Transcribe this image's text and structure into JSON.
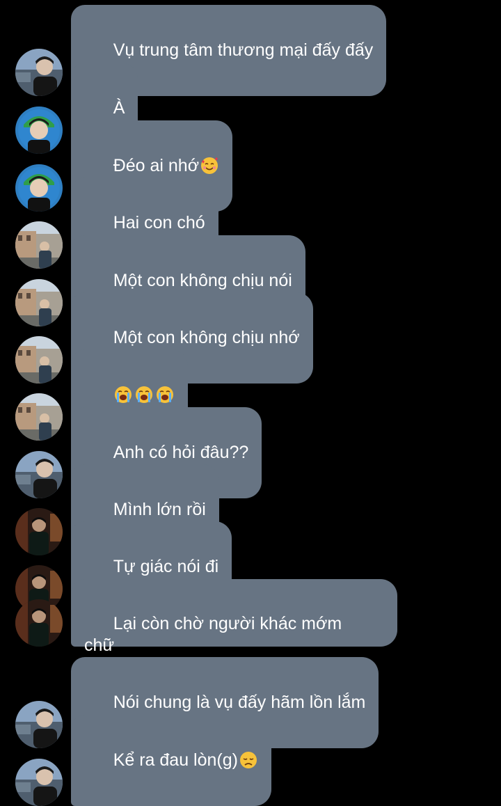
{
  "messages": [
    {
      "avatar": "avatar-city-boy",
      "text": "Vụ trung tâm thương mại đấy đấy"
    },
    {
      "avatar": "avatar-green-cap",
      "text": "À"
    },
    {
      "avatar": "avatar-green-cap",
      "text": "Đéo ai nhớ",
      "emoji": "smiling-face-with-hearts-emoji"
    },
    {
      "avatar": "avatar-old-town",
      "text": "Hai con chó"
    },
    {
      "avatar": "avatar-old-town",
      "text": "Một con không chịu nói"
    },
    {
      "avatar": "avatar-old-town",
      "text": "Một con không chịu nhớ"
    },
    {
      "avatar": "avatar-old-town",
      "text": "",
      "emoji": "loudly-crying-face-emoji x3"
    },
    {
      "avatar": "avatar-city-boy",
      "text": "Anh có hỏi đâu??"
    },
    {
      "avatar": "avatar-dark-room",
      "text": "Mình lớn rồi"
    },
    {
      "avatar": "avatar-dark-room",
      "text": "Tự giác nói đi"
    },
    {
      "avatar": "avatar-dark-room",
      "text": "Lại còn chờ người khác mớm chữ\nvào mồm là sao em"
    },
    {
      "avatar": "avatar-city-boy",
      "text": "Nói chung là vụ đấy hãm lồn lắm"
    },
    {
      "avatar": "avatar-city-boy",
      "text": "Kể ra đau lòn(g)",
      "emoji": "disappointed-face-emoji"
    }
  ],
  "colors": {
    "background": "#000000",
    "bubble": "#677483",
    "text": "#ffffff"
  }
}
